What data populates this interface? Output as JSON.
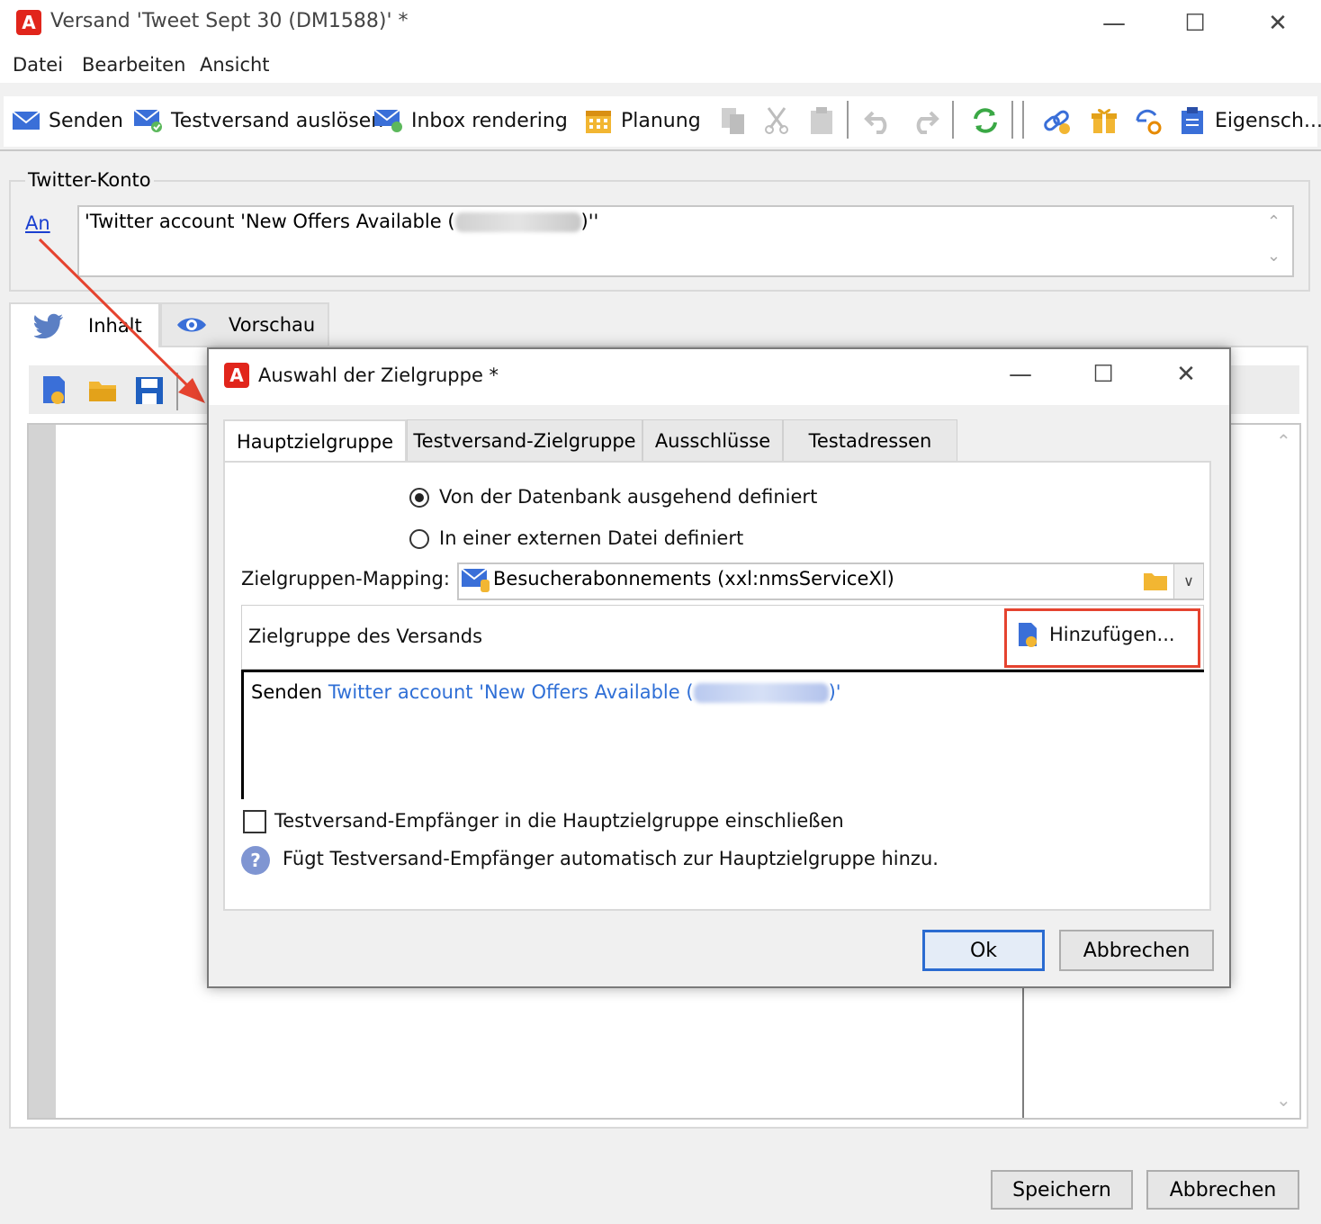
{
  "window": {
    "title": "Versand 'Tweet Sept 30 (DM1588)' *",
    "logo_letter": "A",
    "min": "—",
    "max": "☐",
    "close": "✕"
  },
  "menu": [
    "Datei",
    "Bearbeiten",
    "Ansicht"
  ],
  "toolbar": {
    "send": "Senden",
    "test_send": "Testversand auslösen",
    "inbox": "Inbox rendering",
    "planning": "Planung",
    "properties": "Eigensch..."
  },
  "account_group": {
    "title": "Twitter-Konto",
    "to_link": "An",
    "value_prefix": "'Twitter account 'New Offers Available (",
    "value_suffix": ")''"
  },
  "tabs": {
    "content": "Inhalt",
    "preview": "Vorschau"
  },
  "footer": {
    "save": "Speichern",
    "cancel": "Abbrechen"
  },
  "dialog": {
    "title": "Auswahl der Zielgruppe *",
    "logo_letter": "A",
    "tabs": [
      "Hauptzielgruppe",
      "Testversand-Zielgruppe",
      "Ausschlüsse",
      "Testadressen"
    ],
    "radio_db": "Von der Datenbank ausgehend definiert",
    "radio_file": "In einer externen Datei definiert",
    "mapping_label": "Zielgruppen-Mapping:",
    "mapping_value": "Besucherabonnements (xxl:nmsServiceXl)",
    "section_label": "Zielgruppe des Versands",
    "add_button": "Hinzufügen...",
    "target_verb": "Senden",
    "target_link_prefix": "Twitter account 'New Offers Available (",
    "target_link_suffix": ")'",
    "checkbox_label": "Testversand-Empfänger in die Hauptzielgruppe einschließen",
    "help_text": "Fügt Testversand-Empfänger automatisch zur Hauptzielgruppe hinzu.",
    "help_icon": "?",
    "ok": "Ok",
    "cancel": "Abbrechen"
  }
}
